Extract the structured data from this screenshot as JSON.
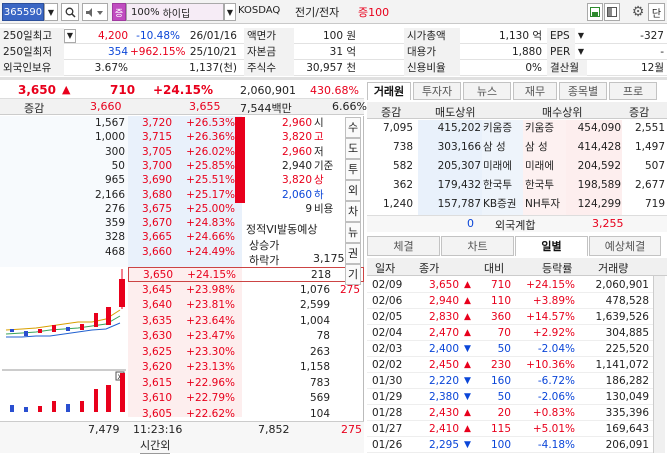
{
  "toolbar": {
    "code": "365590",
    "ratio": "100%",
    "name_tag": "하이딥",
    "market": "KOSDAQ",
    "sector": "전기/전자",
    "margin": "증100",
    "btn_single": "단"
  },
  "info": {
    "r1": {
      "l1": "250일최고",
      "v1": "4,200",
      "p1": "-10.48%",
      "d1": "26/01/16",
      "l2": "액면가",
      "v2": "100 원",
      "l3": "시가총액",
      "v3": "1,130 억",
      "l4": "EPS",
      "v4": "-327"
    },
    "r2": {
      "l1": "250일최저",
      "v1": "354",
      "p1": "+962.15%",
      "d1": "25/10/21",
      "l2": "자본금",
      "v2": "31 억",
      "l3": "대용가",
      "v3": "1,880",
      "l4": "PER",
      "v4": "-"
    },
    "r3": {
      "l1": "외국인보유",
      "v1": "3.67%",
      "d1": "1,137(천)",
      "l2": "주식수",
      "v2": "30,957 천",
      "l3": "신용비율",
      "v3": "0%",
      "l4": "결산월",
      "v4": "12월"
    }
  },
  "price": {
    "current": "3,650",
    "change": "710",
    "rate": "+24.15%",
    "volume": "2,060,901",
    "turnover": "430.68%",
    "label": "증감",
    "p1": "3,660",
    "p2": "3,655",
    "amount": "7,544백만",
    "pct": "6.66%"
  },
  "asks": [
    {
      "qty": "1,567",
      "price": "3,720",
      "rate": "+26.53%"
    },
    {
      "qty": "1,000",
      "price": "3,715",
      "rate": "+26.36%"
    },
    {
      "qty": "300",
      "price": "3,705",
      "rate": "+26.02%"
    },
    {
      "qty": "50",
      "price": "3,700",
      "rate": "+25.85%"
    },
    {
      "qty": "965",
      "price": "3,690",
      "rate": "+25.51%"
    },
    {
      "qty": "2,166",
      "price": "3,680",
      "rate": "+25.17%"
    },
    {
      "qty": "276",
      "price": "3,675",
      "rate": "+25.00%"
    },
    {
      "qty": "359",
      "price": "3,670",
      "rate": "+24.83%"
    },
    {
      "qty": "328",
      "price": "3,665",
      "rate": "+24.66%"
    },
    {
      "qty": "468",
      "price": "3,660",
      "rate": "+24.49%"
    }
  ],
  "bids": [
    {
      "price": "3,650",
      "rate": "+24.15%",
      "qty": "218"
    },
    {
      "price": "3,645",
      "rate": "+23.98%",
      "qty": "1,076",
      "extra": "275"
    },
    {
      "price": "3,640",
      "rate": "+23.81%",
      "qty": "2,599"
    },
    {
      "price": "3,635",
      "rate": "+23.64%",
      "qty": "1,004"
    },
    {
      "price": "3,630",
      "rate": "+23.47%",
      "qty": "78"
    },
    {
      "price": "3,625",
      "rate": "+23.30%",
      "qty": "263"
    },
    {
      "price": "3,620",
      "rate": "+23.13%",
      "qty": "1,158"
    },
    {
      "price": "3,615",
      "rate": "+22.96%",
      "qty": "783"
    },
    {
      "price": "3,610",
      "rate": "+22.79%",
      "qty": "569"
    },
    {
      "price": "3,605",
      "rate": "+22.62%",
      "qty": "104"
    }
  ],
  "ohlc": [
    {
      "v": "2,960",
      "k": "시"
    },
    {
      "v": "3,820",
      "k": "고"
    },
    {
      "v": "2,960",
      "k": "저"
    },
    {
      "v": "2,940",
      "k": "기준"
    },
    {
      "v": "3,820",
      "k": "상"
    },
    {
      "v": "2,060",
      "k": "하"
    },
    {
      "v": "9",
      "k": "비용"
    }
  ],
  "expected": {
    "title": "정적VI발동예상",
    "up_label": "상승가",
    "down_label": "하락가",
    "down_value": "3,175"
  },
  "side_tabs": [
    "수",
    "도",
    "투",
    "외",
    "차",
    "뉴",
    "권",
    "기"
  ],
  "bottom": {
    "ask_total": "7,479",
    "time": "11:23:16",
    "time_label": "시간외",
    "bid_total": "7,852",
    "extra": "275"
  },
  "broker_tabs": [
    "거래원",
    "투자자",
    "뉴스",
    "재무",
    "종목별",
    "프로"
  ],
  "broker_head": {
    "c1": "증감",
    "c2": "매도상위",
    "c3": "매수상위",
    "c4": "증감"
  },
  "brokers": [
    {
      "d1": "7,095",
      "sq": "415,202",
      "sn": "키움증",
      "bn": "키움증",
      "bq": "454,090",
      "d2": "2,551"
    },
    {
      "d1": "738",
      "sq": "303,166",
      "sn": "삼 성",
      "bn": "삼 성",
      "bq": "414,428",
      "d2": "1,497"
    },
    {
      "d1": "582",
      "sq": "205,307",
      "sn": "미래에",
      "bn": "미래에",
      "bq": "204,592",
      "d2": "507"
    },
    {
      "d1": "362",
      "sq": "179,432",
      "sn": "한국투",
      "bn": "한국투",
      "bq": "198,589",
      "d2": "2,677"
    },
    {
      "d1": "1,240",
      "sq": "157,787",
      "sn": "KB증권",
      "bn": "NH투자",
      "bq": "124,299",
      "d2": "719"
    }
  ],
  "foreign": {
    "d1": "0",
    "label": "외국계합",
    "d2": "3,255"
  },
  "daily_tabs": [
    "체결",
    "차트",
    "일별",
    "예상체결"
  ],
  "daily_head": {
    "c1": "일자",
    "c2": "종가",
    "c3": "대비",
    "c4": "등락률",
    "c5": "거래량"
  },
  "daily": [
    {
      "date": "02/09",
      "close": "3,650",
      "dir": "up",
      "diff": "710",
      "rate": "+24.15%",
      "vol": "2,060,901"
    },
    {
      "date": "02/06",
      "close": "2,940",
      "dir": "up",
      "diff": "110",
      "rate": "+3.89%",
      "vol": "478,528"
    },
    {
      "date": "02/05",
      "close": "2,830",
      "dir": "up",
      "diff": "360",
      "rate": "+14.57%",
      "vol": "1,639,526"
    },
    {
      "date": "02/04",
      "close": "2,470",
      "dir": "up",
      "diff": "70",
      "rate": "+2.92%",
      "vol": "304,885"
    },
    {
      "date": "02/03",
      "close": "2,400",
      "dir": "down",
      "diff": "50",
      "rate": "-2.04%",
      "vol": "225,520"
    },
    {
      "date": "02/02",
      "close": "2,450",
      "dir": "up",
      "diff": "230",
      "rate": "+10.36%",
      "vol": "1,141,072"
    },
    {
      "date": "01/30",
      "close": "2,220",
      "dir": "down",
      "diff": "160",
      "rate": "-6.72%",
      "vol": "186,282"
    },
    {
      "date": "01/29",
      "close": "2,380",
      "dir": "down",
      "diff": "50",
      "rate": "-2.06%",
      "vol": "130,049"
    },
    {
      "date": "01/28",
      "close": "2,430",
      "dir": "up",
      "diff": "20",
      "rate": "+0.83%",
      "vol": "335,396"
    },
    {
      "date": "01/27",
      "close": "2,410",
      "dir": "up",
      "diff": "115",
      "rate": "+5.01%",
      "vol": "169,643"
    },
    {
      "date": "01/26",
      "close": "2,295",
      "dir": "down",
      "diff": "100",
      "rate": "-4.18%",
      "vol": "206,091"
    }
  ],
  "colors": {
    "red": "#e8001c",
    "blue": "#0b46d8",
    "ask_bg": "#e9f1fb",
    "bid_bg": "#fdeeee"
  }
}
